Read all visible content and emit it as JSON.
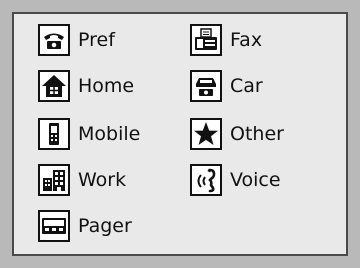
{
  "legend": {
    "items": [
      {
        "id": "pref",
        "label": "Pref",
        "icon": "phone-icon"
      },
      {
        "id": "fax",
        "label": "Fax",
        "icon": "fax-icon"
      },
      {
        "id": "home",
        "label": "Home",
        "icon": "home-icon"
      },
      {
        "id": "car",
        "label": "Car",
        "icon": "car-phone-icon"
      },
      {
        "id": "mobile",
        "label": "Mobile",
        "icon": "mobile-icon"
      },
      {
        "id": "other",
        "label": "Other",
        "icon": "star-icon"
      },
      {
        "id": "work",
        "label": "Work",
        "icon": "building-icon"
      },
      {
        "id": "voice",
        "label": "Voice",
        "icon": "voice-icon"
      },
      {
        "id": "pager",
        "label": "Pager",
        "icon": "pager-icon"
      }
    ]
  }
}
